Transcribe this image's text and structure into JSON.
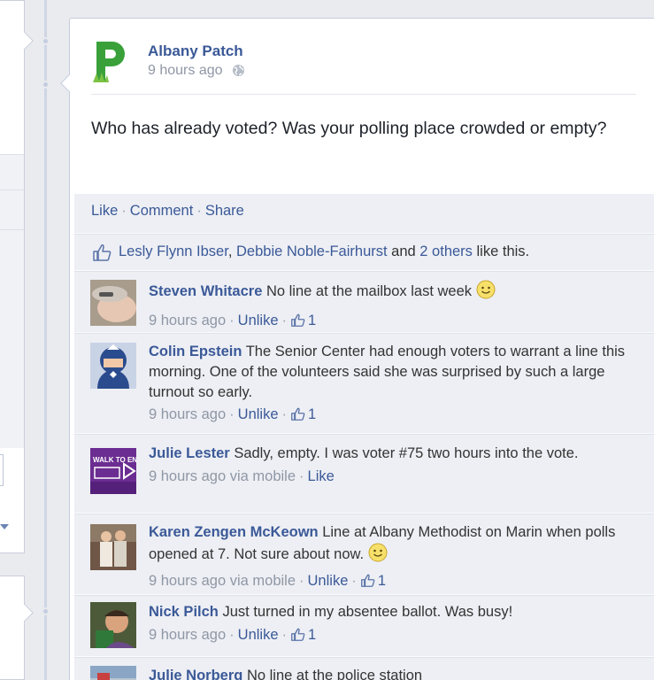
{
  "post": {
    "page_name": "Albany Patch",
    "timestamp": "9 hours ago",
    "message": "Who has already voted? Was your polling place crowded or empty?",
    "logo_letter": "P"
  },
  "actions": {
    "like": "Like",
    "comment": "Comment",
    "share": "Share"
  },
  "likes": {
    "name1": "Lesly Flynn Ibser",
    "sep1": ",",
    "name2": "Debbie Noble-Fairhurst",
    "and": "and",
    "others": "2 others",
    "suffix": "like this."
  },
  "comments": [
    {
      "author": "Steven Whitacre",
      "text": "No line at the mailbox last week",
      "time": "9 hours ago",
      "action": "Unlike",
      "likes": "1",
      "emoticon": "smile"
    },
    {
      "author": "Colin Epstein",
      "text": "The Senior Center had enough voters to warrant a line this morning. One of the volunteers said she was surprised by such a large turnout so early.",
      "time": "9 hours ago",
      "action": "Unlike",
      "likes": "1"
    },
    {
      "author": "Julie Lester",
      "text": "Sadly, empty. I was voter #75 two hours into the vote.",
      "time": "9 hours ago via mobile",
      "action": "Like",
      "avatar_text": "WALK TO END"
    },
    {
      "author": "Karen Zengen McKeown",
      "text": "Line at Albany Methodist on Marin when polls opened at 7. Not sure about now.",
      "time": "9 hours ago via mobile",
      "action": "Unlike",
      "likes": "1",
      "emoticon": "smile"
    },
    {
      "author": "Nick Pilch",
      "text": "Just turned in my absentee ballot. Was busy!",
      "time": "9 hours ago",
      "action": "Unlike",
      "likes": "1"
    },
    {
      "author": "Julie Norberg",
      "text": "No line at the police station"
    }
  ],
  "colors": {
    "link": "#3b5998",
    "meta": "#8f97a5",
    "ufi_bg": "#edeff4",
    "logo_green": "#3aa13a"
  }
}
